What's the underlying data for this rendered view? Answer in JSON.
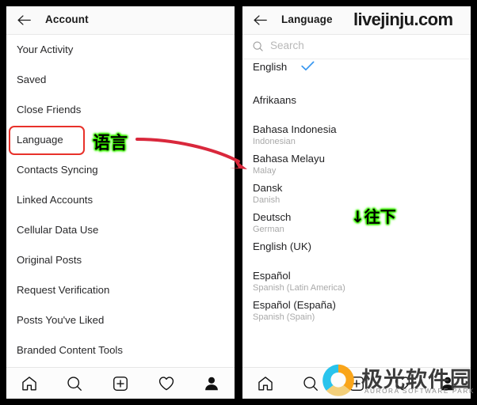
{
  "left_panel": {
    "header": {
      "back_icon": "back-arrow-icon",
      "title": "Account"
    },
    "items": [
      {
        "label": "Your Activity"
      },
      {
        "label": "Saved"
      },
      {
        "label": "Close Friends"
      },
      {
        "label": "Language"
      },
      {
        "label": "Contacts Syncing"
      },
      {
        "label": "Linked Accounts"
      },
      {
        "label": "Cellular Data Use"
      },
      {
        "label": "Original Posts"
      },
      {
        "label": "Request Verification"
      },
      {
        "label": "Posts You've Liked"
      },
      {
        "label": "Branded Content Tools"
      }
    ],
    "nav": [
      {
        "icon": "home-icon"
      },
      {
        "icon": "search-icon"
      },
      {
        "icon": "new-post-icon"
      },
      {
        "icon": "heart-icon"
      },
      {
        "icon": "profile-icon"
      }
    ]
  },
  "right_panel": {
    "header": {
      "back_icon": "back-arrow-icon",
      "title": "Language"
    },
    "watermark": "livejinju.com",
    "search": {
      "icon": "search-icon",
      "placeholder": "Search",
      "value": ""
    },
    "languages": [
      {
        "name": "English",
        "sub": "",
        "selected": true
      },
      {
        "name": "Afrikaans",
        "sub": "",
        "selected": false
      },
      {
        "name": "Bahasa Indonesia",
        "sub": "Indonesian",
        "selected": false
      },
      {
        "name": "Bahasa Melayu",
        "sub": "Malay",
        "selected": false
      },
      {
        "name": "Dansk",
        "sub": "Danish",
        "selected": false
      },
      {
        "name": "Deutsch",
        "sub": "German",
        "selected": false
      },
      {
        "name": "English (UK)",
        "sub": "",
        "selected": false
      },
      {
        "name": "Español",
        "sub": "Spanish (Latin America)",
        "selected": false
      },
      {
        "name": "Español (España)",
        "sub": "Spanish (Spain)",
        "selected": false
      }
    ],
    "nav": [
      {
        "icon": "home-icon"
      },
      {
        "icon": "search-icon"
      }
    ]
  },
  "annotations": {
    "highlight_box_color": "#e8312a",
    "language_label": "语言",
    "scroll_label": "↓往下",
    "arrow_color": "#d9283c",
    "glow_color": "#39f000",
    "checkmark_color": "#3897f0"
  },
  "logo": {
    "cn_text": "极光软件园",
    "en_text": "AURORA SOFTWARE PARK",
    "colors": {
      "cyan": "#29c3ec",
      "orange": "#f9a51a",
      "tan": "#f3cf7a"
    }
  }
}
